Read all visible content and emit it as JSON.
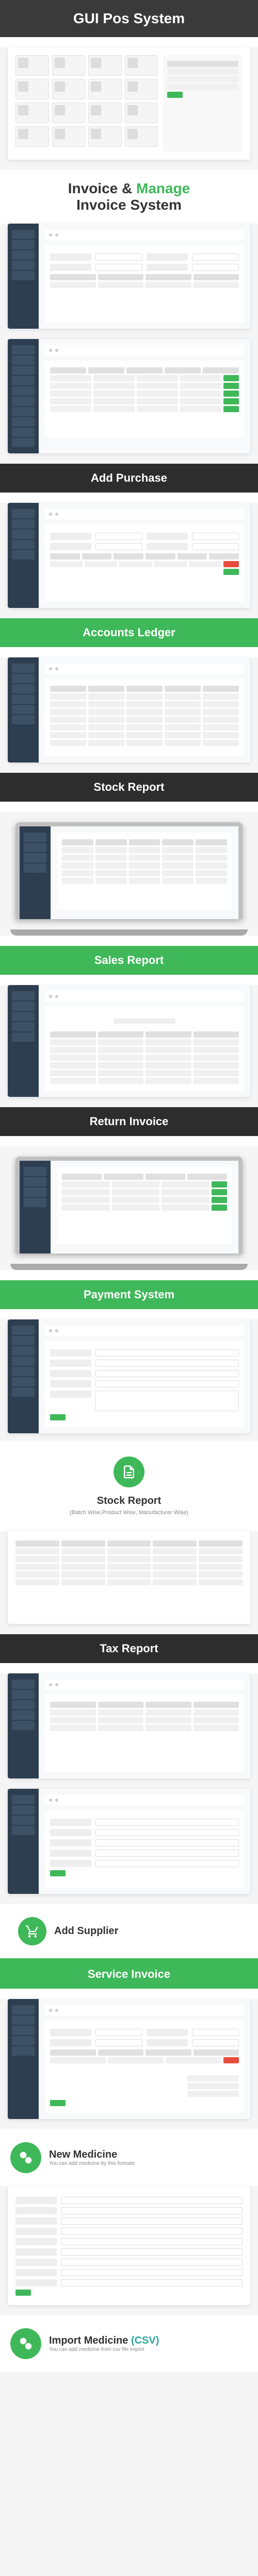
{
  "sections": {
    "gui_pos": {
      "title": "GUI Pos System"
    },
    "invoice_manage": {
      "title_a": "Invoice & ",
      "title_b": "Manage",
      "title_c": "Invoice System"
    },
    "add_purchase": {
      "title": "Add Purchase"
    },
    "accounts_ledger": {
      "title": "Accounts Ledger"
    },
    "stock_report": {
      "title": "Stock Report"
    },
    "sales_report": {
      "title": "Sales Report"
    },
    "return_invoice": {
      "title": "Return Invoice"
    },
    "payment_system": {
      "title": "Payment System"
    },
    "stock_report_feature": {
      "title": "Stock Report",
      "subtitle": "(Batch Wise,Product Wise, Manufacturer Wise)"
    },
    "tax_report": {
      "title": "Tax Report"
    },
    "add_supplier": {
      "title": "Add Supplier"
    },
    "service_invoice": {
      "title": "Service Invoice"
    },
    "new_medicine": {
      "title": "New Medicine",
      "subtitle": "You can add medicine by this formate"
    },
    "import_medicine": {
      "title_a": "Import Medicine ",
      "title_b": "(CSV)",
      "subtitle": "You can add medicine from csv file import"
    }
  }
}
